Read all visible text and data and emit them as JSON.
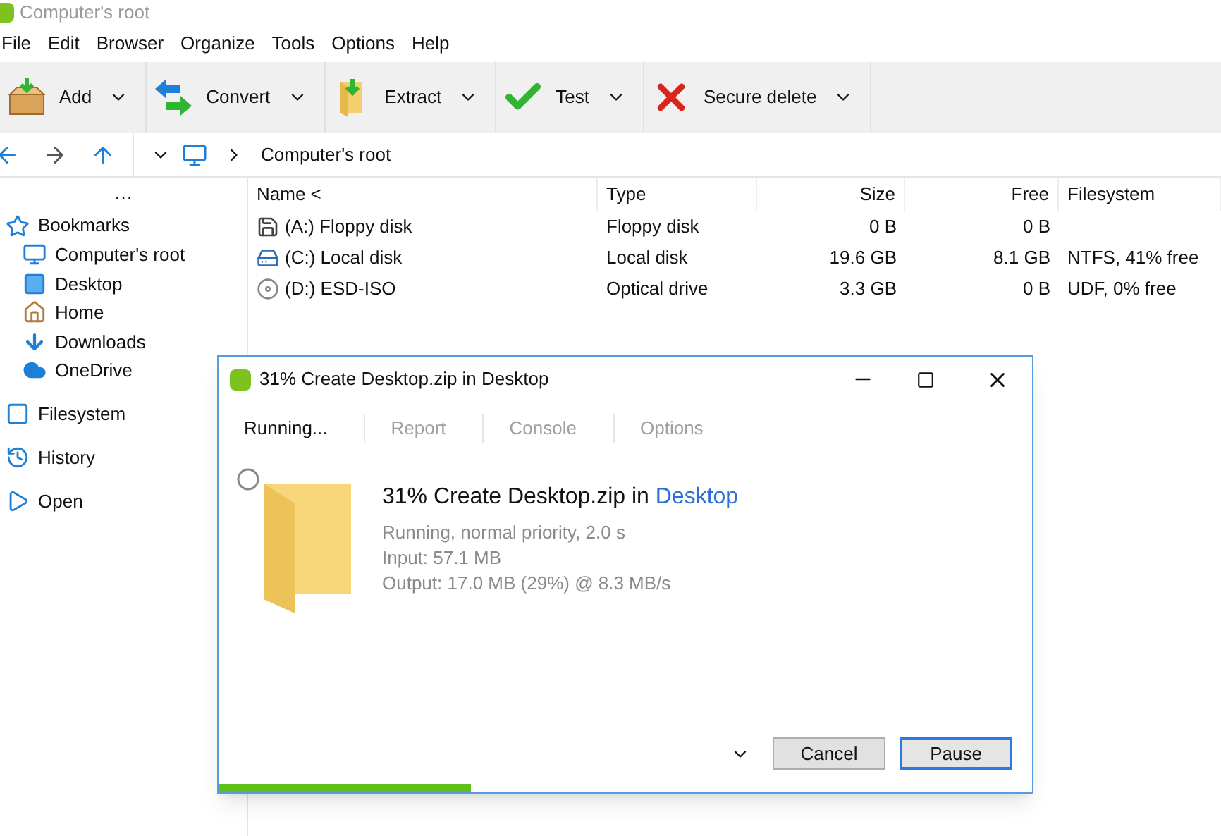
{
  "window": {
    "title": "Computer's root"
  },
  "menu": [
    "File",
    "Edit",
    "Browser",
    "Organize",
    "Tools",
    "Options",
    "Help"
  ],
  "toolbar": [
    {
      "kind": "add",
      "label": "Add"
    },
    {
      "kind": "convert",
      "label": "Convert"
    },
    {
      "kind": "extract",
      "label": "Extract"
    },
    {
      "kind": "test",
      "label": "Test"
    },
    {
      "kind": "delete",
      "label": "Secure delete"
    }
  ],
  "address": {
    "path": "Computer's root"
  },
  "sidebar": {
    "more": "···",
    "sections": [
      {
        "kind": "bookmarks",
        "label": "Bookmarks",
        "children": [
          {
            "kind": "computer",
            "label": "Computer's root"
          },
          {
            "kind": "desktop",
            "label": "Desktop"
          },
          {
            "kind": "home",
            "label": "Home"
          },
          {
            "kind": "downloads",
            "label": "Downloads"
          },
          {
            "kind": "cloud",
            "label": "OneDrive"
          }
        ]
      },
      {
        "kind": "filesystem",
        "label": "Filesystem"
      },
      {
        "kind": "history",
        "label": "History"
      },
      {
        "kind": "open",
        "label": "Open"
      }
    ]
  },
  "table": {
    "columns": [
      "Name <",
      "Type",
      "Size",
      "Free",
      "Filesystem"
    ],
    "rows": [
      {
        "kind": "floppy",
        "name": "(A:) Floppy disk",
        "type": "Floppy disk",
        "size": "0 B",
        "free": "0 B"
      },
      {
        "kind": "disk",
        "name": "(C:) Local disk",
        "type": "Local disk",
        "size": "19.6 GB",
        "free": "8.1 GB",
        "filesystem": "NTFS, 41% free"
      },
      {
        "kind": "optical",
        "name": "(D:) ESD-ISO",
        "type": "Optical drive",
        "size": "3.3 GB",
        "free": "0 B",
        "filesystem": "UDF, 0% free"
      }
    ]
  },
  "dialog": {
    "title": "31% Create Desktop.zip in Desktop",
    "tabs": [
      {
        "label": "Running...",
        "selected": true
      },
      {
        "label": "Report",
        "selected": false
      },
      {
        "label": "Console",
        "selected": false
      },
      {
        "label": "Options",
        "selected": false
      }
    ],
    "heading": "31% Create Desktop.zip in ",
    "heading_link": "Desktop",
    "details": [
      "Running, normal priority, 2.0 s",
      "Input: 57.1 MB",
      "Output: 17.0 MB (29%) @ 8.3 MB/s"
    ],
    "buttons": [
      "Cancel",
      "Pause"
    ],
    "progress": {
      "level": 0.31
    }
  }
}
